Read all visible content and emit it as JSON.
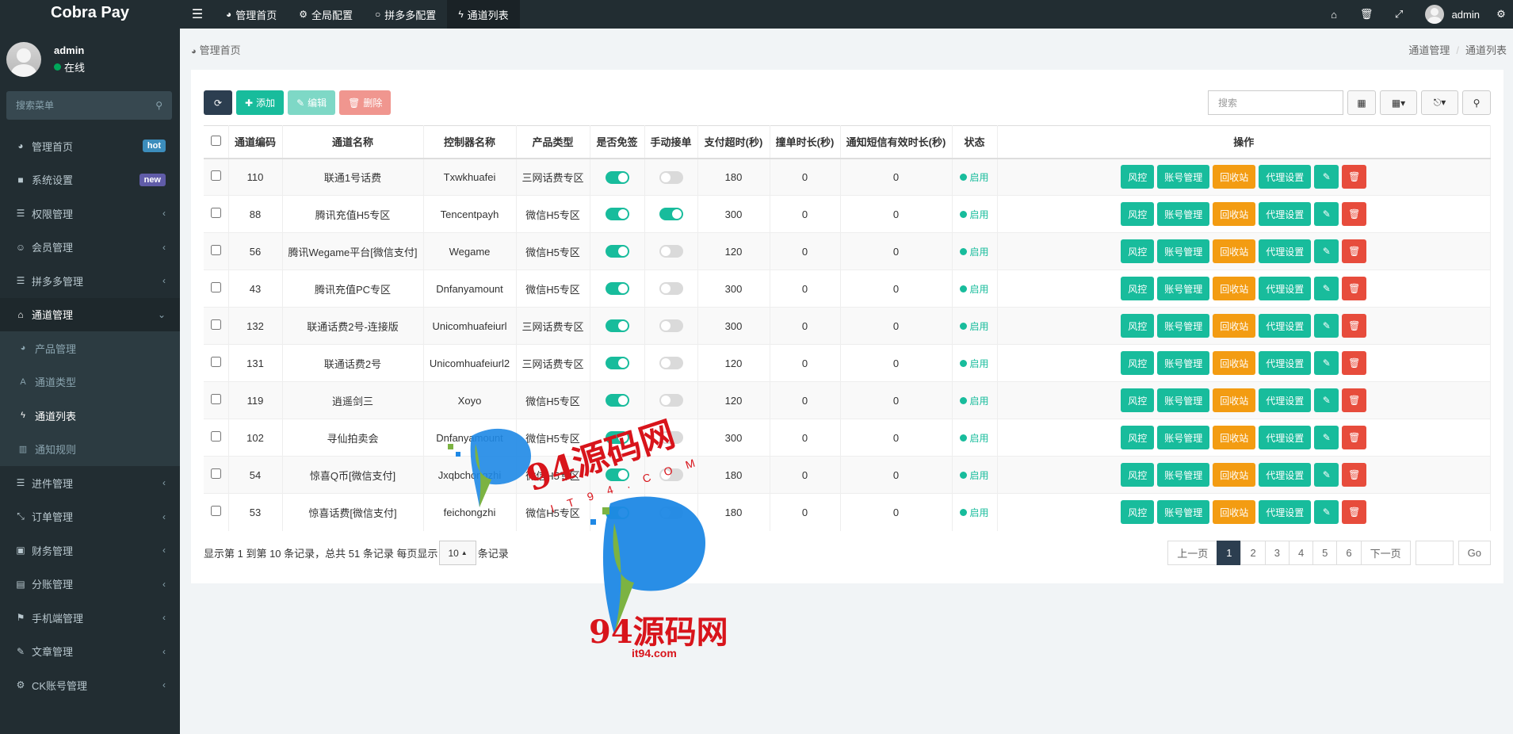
{
  "brand": "Cobra Pay",
  "user": {
    "name": "admin",
    "status": "在线"
  },
  "sidebar": {
    "search_placeholder": "搜索菜单",
    "items": [
      {
        "icon": "dashboard-icon",
        "label": "管理首页",
        "badge": "hot"
      },
      {
        "icon": "folder-icon",
        "label": "系统设置",
        "badge": "new"
      },
      {
        "icon": "list-icon",
        "label": "权限管理"
      },
      {
        "icon": "users-icon",
        "label": "会员管理"
      },
      {
        "icon": "list-icon",
        "label": "拼多多管理"
      },
      {
        "icon": "cart-icon",
        "label": "通道管理"
      },
      {
        "icon": "list-icon",
        "label": "进件管理"
      },
      {
        "icon": "compress-icon",
        "label": "订单管理"
      },
      {
        "icon": "finance-icon",
        "label": "财务管理"
      },
      {
        "icon": "book-icon",
        "label": "分账管理"
      },
      {
        "icon": "flag-icon",
        "label": "手机端管理"
      },
      {
        "icon": "brush-icon",
        "label": "文章管理"
      },
      {
        "icon": "gear-icon",
        "label": "CK账号管理"
      }
    ],
    "submenu": [
      {
        "icon": "dashboard-icon",
        "label": "产品管理"
      },
      {
        "icon": "font-icon",
        "label": "通道类型"
      },
      {
        "icon": "bolt-icon",
        "label": "通道列表"
      },
      {
        "icon": "file-icon",
        "label": "通知规则"
      }
    ]
  },
  "topnav": [
    {
      "icon": "dashboard-icon",
      "label": "管理首页"
    },
    {
      "icon": "gears-icon",
      "label": "全局配置"
    },
    {
      "icon": "circle-icon",
      "label": "拼多多配置"
    },
    {
      "icon": "bolt-icon",
      "label": "通道列表"
    }
  ],
  "breadcrumb": {
    "left": "管理首页",
    "path": [
      "通道管理",
      "通道列表"
    ]
  },
  "toolbar": {
    "add": "添加",
    "edit": "编辑",
    "delete": "删除",
    "search_placeholder": "搜索"
  },
  "table": {
    "headers": [
      "通道编码",
      "通道名称",
      "控制器名称",
      "产品类型",
      "是否免签",
      "手动接单",
      "支付超时(秒)",
      "撞单时长(秒)",
      "通知短信有效时长(秒)",
      "状态",
      "操作"
    ],
    "rows": [
      {
        "code": "110",
        "name": "联通1号话费",
        "controller": "Txwkhuafei",
        "type": "三网话费专区",
        "free": true,
        "manual": false,
        "timeout": "180",
        "collide": "0",
        "sms": "0",
        "status": "启用"
      },
      {
        "code": "88",
        "name": "腾讯充值H5专区",
        "controller": "Tencentpayh",
        "type": "微信H5专区",
        "free": true,
        "manual": true,
        "timeout": "300",
        "collide": "0",
        "sms": "0",
        "status": "启用"
      },
      {
        "code": "56",
        "name": "腾讯Wegame平台[微信支付]",
        "controller": "Wegame",
        "type": "微信H5专区",
        "free": true,
        "manual": false,
        "timeout": "120",
        "collide": "0",
        "sms": "0",
        "status": "启用"
      },
      {
        "code": "43",
        "name": "腾讯充值PC专区",
        "controller": "Dnfanyamount",
        "type": "微信H5专区",
        "free": true,
        "manual": false,
        "timeout": "300",
        "collide": "0",
        "sms": "0",
        "status": "启用"
      },
      {
        "code": "132",
        "name": "联通话费2号-连接版",
        "controller": "Unicomhuafeiurl",
        "type": "三网话费专区",
        "free": true,
        "manual": false,
        "timeout": "300",
        "collide": "0",
        "sms": "0",
        "status": "启用"
      },
      {
        "code": "131",
        "name": "联通话费2号",
        "controller": "Unicomhuafeiurl2",
        "type": "三网话费专区",
        "free": true,
        "manual": false,
        "timeout": "120",
        "collide": "0",
        "sms": "0",
        "status": "启用"
      },
      {
        "code": "119",
        "name": "逍遥剑三",
        "controller": "Xoyo",
        "type": "微信H5专区",
        "free": true,
        "manual": false,
        "timeout": "120",
        "collide": "0",
        "sms": "0",
        "status": "启用"
      },
      {
        "code": "102",
        "name": "寻仙拍卖会",
        "controller": "Dnfanyamount",
        "type": "微信H5专区",
        "free": true,
        "manual": false,
        "timeout": "300",
        "collide": "0",
        "sms": "0",
        "status": "启用"
      },
      {
        "code": "54",
        "name": "惊喜Q币[微信支付]",
        "controller": "Jxqbchongzhi",
        "type": "微信H5专区",
        "free": true,
        "manual": false,
        "timeout": "180",
        "collide": "0",
        "sms": "0",
        "status": "启用"
      },
      {
        "code": "53",
        "name": "惊喜话费[微信支付]",
        "controller": "feichongzhi",
        "type": "微信H5专区",
        "free": true,
        "manual": false,
        "timeout": "180",
        "collide": "0",
        "sms": "0",
        "status": "启用"
      }
    ],
    "actions": [
      "风控",
      "账号管理",
      "回收站",
      "代理设置"
    ]
  },
  "footer": {
    "summary_prefix": "显示第 1 到第 10 条记录，总共 51 条记录 每页显示",
    "page_size": "10",
    "summary_suffix": "条记录",
    "prev": "上一页",
    "pages": [
      "1",
      "2",
      "3",
      "4",
      "5",
      "6"
    ],
    "next": "下一页",
    "go": "Go"
  },
  "watermark": {
    "text": "94源码网",
    "domain": "it94.com",
    "tilted_domain": "IT94.COM"
  },
  "colors": {
    "sidebar": "#222d32",
    "accent": "#18bc9c",
    "warning": "#f39c12",
    "danger": "#e74c3c",
    "primary_dark": "#2c3e50"
  }
}
